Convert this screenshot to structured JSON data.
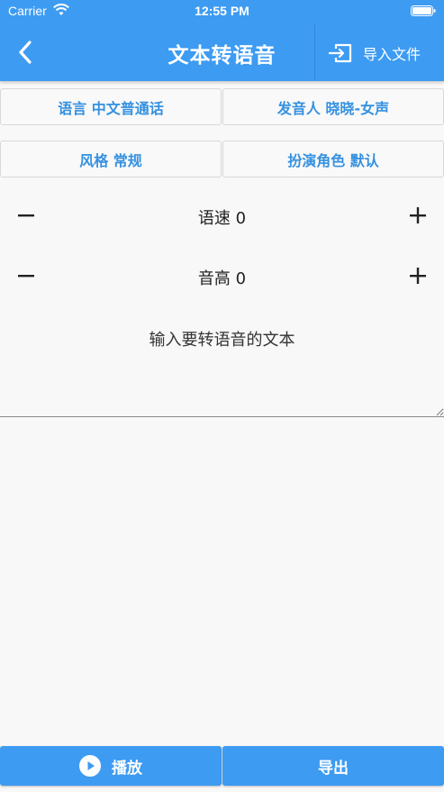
{
  "status_bar": {
    "carrier": "Carrier",
    "time": "12:55 PM"
  },
  "header": {
    "title": "文本转语音",
    "import_label": "导入文件"
  },
  "options": {
    "language": "语言 中文普通话",
    "speaker": "发音人 晓晓-女声",
    "style": "风格 常规",
    "role": "扮演角色 默认"
  },
  "adjust": {
    "speed_label": "语速 0",
    "pitch_label": "音高 0"
  },
  "input": {
    "placeholder": "输入要转语音的文本"
  },
  "bottom": {
    "play_label": "播放",
    "export_label": "导出"
  },
  "colors": {
    "accent": "#3d9bf2",
    "option_text": "#3591e0"
  }
}
